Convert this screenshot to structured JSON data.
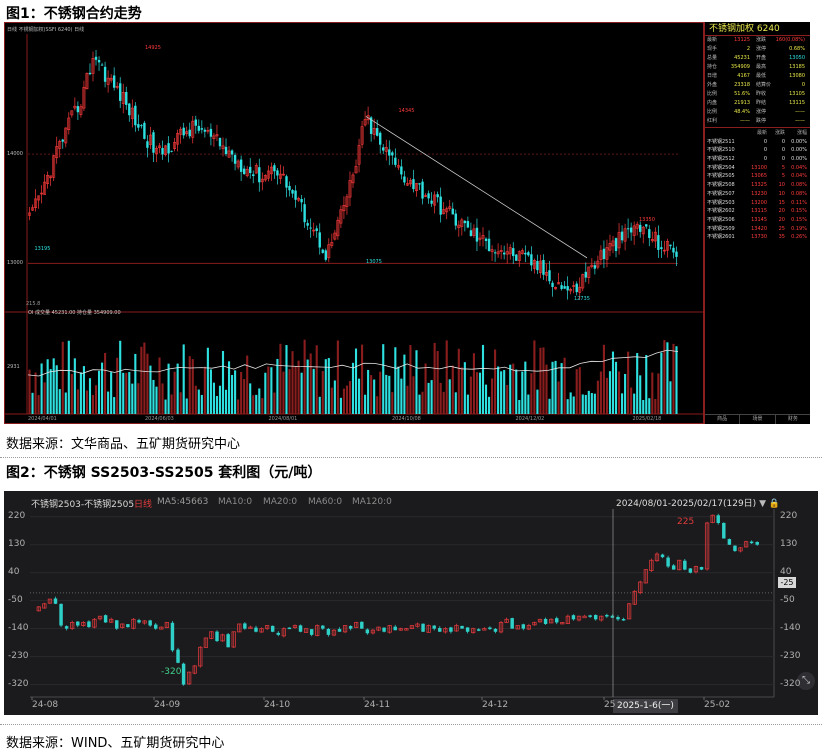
{
  "fig1": {
    "title": "图1：不锈钢合约走势",
    "source": "数据来源：文华商品、五矿期货研究中心"
  },
  "fig2": {
    "title": "图2：不锈钢 SS2503-SS2505 套利图（元/吨）",
    "source": "数据来源：WIND、五矿期货研究中心"
  },
  "chart_data": [
    {
      "type": "candlestick",
      "title": "不锈钢加权 6240",
      "legend_text": "日线 不锈钢加权(SSFI 6240) 日线",
      "volume_legend": "OI 成交量 45231.00 持仓量 354909.00",
      "price_ticks": [
        "14000",
        "13000"
      ],
      "volume_ticks": [
        "215.8",
        "2931"
      ],
      "date_ticks": [
        "2024/04/01",
        "2024/06/03",
        "2024/08/01",
        "2024/10/08",
        "2024/12/02",
        "2025/02/18"
      ],
      "annotations": {
        "high": "14925",
        "mid_high": "14345",
        "low1": "13195",
        "low2": "13075",
        "low3": "12735",
        "recent_high": "13350"
      },
      "close_path": [
        13400,
        13650,
        14000,
        14250,
        14500,
        14925,
        14700,
        14550,
        14350,
        14150,
        14000,
        14100,
        14200,
        14250,
        14150,
        14050,
        13950,
        13850,
        13800,
        13900,
        13700,
        13500,
        13300,
        13075,
        13400,
        13800,
        14345,
        14100,
        13950,
        13800,
        13700,
        13600,
        13500,
        13400,
        13300,
        13200,
        13150,
        13100,
        13050,
        13000,
        12900,
        12800,
        12735,
        12900,
        13050,
        13150,
        13250,
        13350,
        13250,
        13150,
        13100
      ],
      "quote_panel": {
        "rows": [
          [
            "最新",
            "13125",
            "涨跌",
            "160(0.08%)"
          ],
          [
            "现手",
            "2",
            "涨停",
            "0.68%"
          ],
          [
            "总量",
            "45231",
            "开盘",
            "13050"
          ],
          [
            "持仓",
            "354909",
            "最高",
            "13185"
          ],
          [
            "日增",
            "4167",
            "最低",
            "13080"
          ],
          [
            "外盘",
            "23318",
            "结算价",
            "0"
          ],
          [
            "比例",
            "51.6%",
            "昨收",
            "13105"
          ],
          [
            "内盘",
            "21913",
            "昨结",
            "13115"
          ],
          [
            "比例",
            "48.4%",
            "涨停",
            "——"
          ],
          [
            "红利",
            "——",
            "跌停",
            "——"
          ]
        ],
        "contract_header": [
          "",
          "最新",
          "涨跌",
          "涨幅"
        ],
        "contracts": [
          [
            "不锈钢2511",
            "0",
            "0",
            "0.00%"
          ],
          [
            "不锈钢2510",
            "0",
            "0",
            "0.00%"
          ],
          [
            "不锈钢2512",
            "0",
            "0",
            "0.00%"
          ],
          [
            "不锈钢2504",
            "13100",
            "5",
            "0.04%"
          ],
          [
            "不锈钢2505",
            "13065",
            "5",
            "0.04%"
          ],
          [
            "不锈钢2508",
            "13325",
            "10",
            "0.08%"
          ],
          [
            "不锈钢2507",
            "13230",
            "10",
            "0.08%"
          ],
          [
            "不锈钢2503",
            "13200",
            "15",
            "0.11%"
          ],
          [
            "不锈钢2602",
            "13115",
            "20",
            "0.15%"
          ],
          [
            "不锈钢2506",
            "13145",
            "20",
            "0.15%"
          ],
          [
            "不锈钢2509",
            "13420",
            "25",
            "0.19%"
          ],
          [
            "不锈钢2601",
            "13730",
            "35",
            "0.26%"
          ]
        ],
        "tabs": [
          "商品",
          "场景",
          "财务"
        ]
      }
    },
    {
      "type": "candlestick",
      "title": "不锈钢2503-不锈钢2505",
      "period": "日线",
      "ma": [
        "MA5:45663",
        "MA10:0",
        "MA20:0",
        "MA60:0",
        "MA120:0"
      ],
      "range_label": "2024/08/01-2025/02/17(129日)",
      "y_ticks": [
        220,
        130,
        40,
        -50,
        -140,
        -230,
        -320
      ],
      "ylim": [
        -360,
        245
      ],
      "x_ticks": [
        "24-08",
        "24-09",
        "24-10",
        "24-11",
        "24-12",
        "25",
        "25-02"
      ],
      "current_value": "-25",
      "date_tag": "2025-1-6(一)",
      "annotations": {
        "low": "-320",
        "high": "225"
      },
      "candles_close": [
        -70,
        -60,
        -45,
        -60,
        -130,
        -140,
        -120,
        -130,
        -120,
        -135,
        -110,
        -100,
        -120,
        -110,
        -140,
        -125,
        -135,
        -110,
        -120,
        -115,
        -130,
        -140,
        -135,
        -120,
        -210,
        -250,
        -320,
        -280,
        -260,
        -200,
        -170,
        -150,
        -180,
        -160,
        -200,
        -150,
        -125,
        -140,
        -135,
        -150,
        -140,
        -130,
        -150,
        -160,
        -140,
        -140,
        -130,
        -150,
        -140,
        -160,
        -130,
        -140,
        -160,
        -145,
        -150,
        -130,
        -140,
        -120,
        -140,
        -155,
        -145,
        -135,
        -150,
        -130,
        -145,
        -140,
        -140,
        -130,
        -125,
        -150,
        -130,
        -140,
        -150,
        -140,
        -150,
        -130,
        -140,
        -150,
        -140,
        -145,
        -140,
        -140,
        -150,
        -120,
        -110,
        -140,
        -130,
        -140,
        -130,
        -120,
        -110,
        -125,
        -110,
        -120,
        -120,
        -100,
        -110,
        -100,
        -100,
        -100,
        -110,
        -100,
        -100,
        -105,
        -110,
        -110,
        -60,
        -20,
        10,
        50,
        80,
        100,
        90,
        60,
        50,
        80,
        50,
        40,
        60,
        50,
        200,
        225,
        200,
        150,
        130,
        110,
        120,
        140,
        135,
        130
      ]
    }
  ]
}
